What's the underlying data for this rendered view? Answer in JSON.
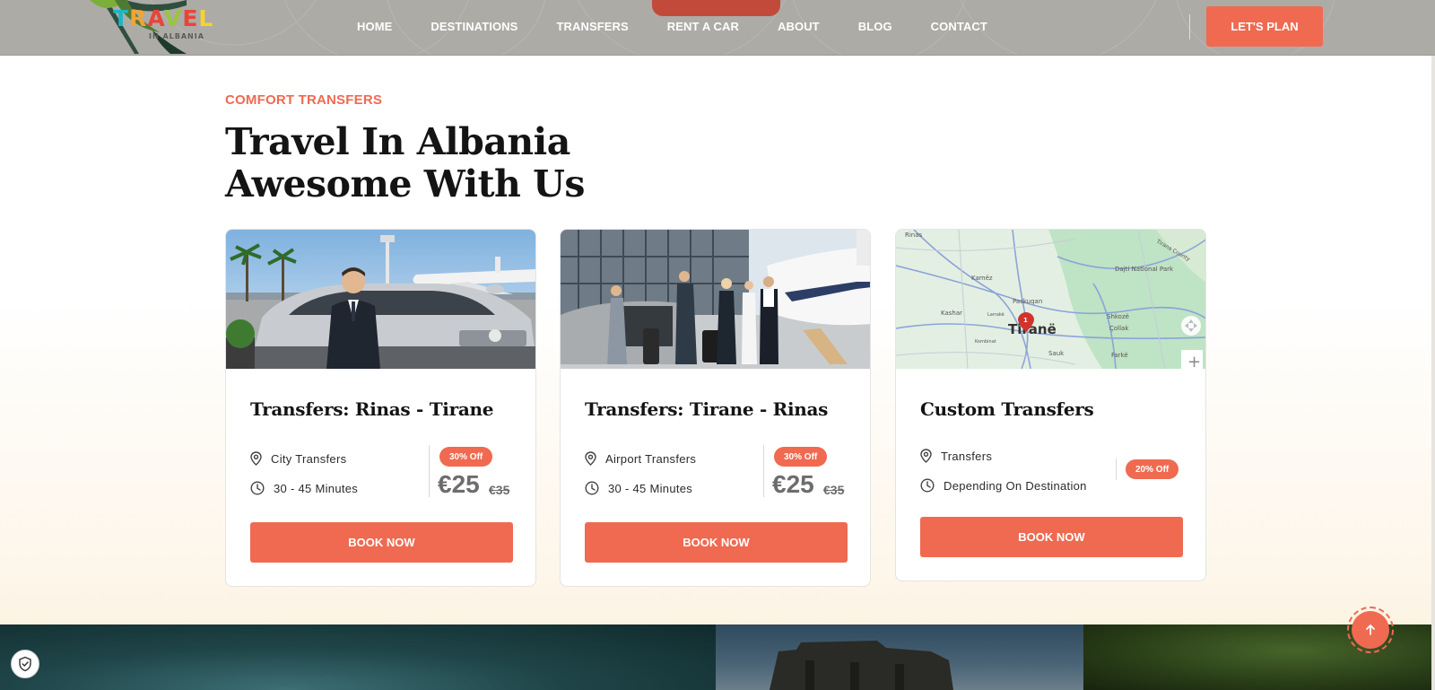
{
  "nav": {
    "logo_letters": [
      "T",
      "R",
      "A",
      "V",
      "E",
      "L"
    ],
    "logo_sub": "IN ALBANIA",
    "items": [
      {
        "label": "HOME"
      },
      {
        "label": "DESTINATIONS"
      },
      {
        "label": "TRANSFERS"
      },
      {
        "label": "RENT A CAR"
      },
      {
        "label": "ABOUT"
      },
      {
        "label": "BLOG"
      },
      {
        "label": "CONTACT"
      }
    ],
    "cta_label": "LET'S PLAN"
  },
  "section": {
    "eyebrow": "COMFORT TRANSFERS",
    "title_line1": "Travel In Albania",
    "title_line2": "Awesome With Us"
  },
  "cards": [
    {
      "title": "Transfers: Rinas - Tirane",
      "location": "City Transfers",
      "duration": "30 - 45 Minutes",
      "badge": "30% Off",
      "price": "€25",
      "old_price": "€35",
      "book_label": "BOOK NOW"
    },
    {
      "title": "Transfers: Tirane - Rinas",
      "location": "Airport Transfers",
      "duration": "30 - 45 Minutes",
      "badge": "30% Off",
      "price": "€25",
      "old_price": "€35",
      "book_label": "BOOK NOW"
    },
    {
      "title": "Custom Transfers",
      "location": "Transfers",
      "duration": "Depending On Destination",
      "badge": "20% Off",
      "book_label": "BOOK NOW",
      "map": {
        "city_label": "Tiranë",
        "pin_number": "1",
        "places": [
          "Kamëz",
          "Paskuqan",
          "Kashar",
          "Shkozë",
          "Çollak",
          "Kombinat",
          "Sauk",
          "Farkë",
          "Dajti National Park",
          "Tirana County",
          "Rinas",
          "Larrakë"
        ],
        "zoom_label": "+"
      }
    }
  ],
  "colors": {
    "accent": "#ef6a51",
    "header_bg": "#adaba6",
    "title": "#141414"
  },
  "icons": {
    "location": "map-pin-icon",
    "duration": "clock-icon",
    "scroll_top": "arrow-up-icon",
    "privacy": "shield-check-icon"
  }
}
